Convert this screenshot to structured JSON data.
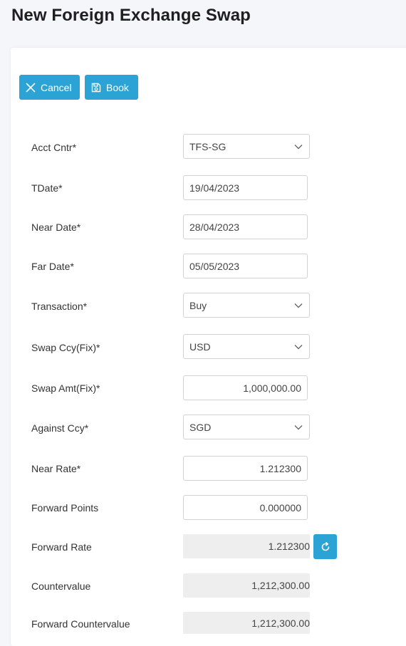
{
  "page": {
    "title": "New Foreign Exchange Swap"
  },
  "toolbar": {
    "cancel_label": "Cancel",
    "book_label": "Book"
  },
  "form": {
    "acct_cntr": {
      "label": "Acct Cntr*",
      "value": "TFS-SG"
    },
    "tdate": {
      "label": "TDate*",
      "value": "19/04/2023"
    },
    "near_date": {
      "label": "Near Date*",
      "value": "28/04/2023"
    },
    "far_date": {
      "label": "Far Date*",
      "value": "05/05/2023"
    },
    "transaction": {
      "label": "Transaction*",
      "value": "Buy"
    },
    "swap_ccy": {
      "label": "Swap Ccy(Fix)*",
      "value": "USD"
    },
    "swap_amt": {
      "label": "Swap Amt(Fix)*",
      "value": "1,000,000.00"
    },
    "against_ccy": {
      "label": "Against Ccy*",
      "value": "SGD"
    },
    "near_rate": {
      "label": "Near Rate*",
      "value": "1.212300"
    },
    "forward_points": {
      "label": "Forward Points",
      "value": "0.000000"
    },
    "forward_rate": {
      "label": "Forward Rate",
      "value": "1.212300"
    },
    "countervalue": {
      "label": "Countervalue",
      "value": "1,212,300.00"
    },
    "forward_countervalue": {
      "label": "Forward Countervalue",
      "value": "1,212,300.00"
    }
  },
  "icons": {
    "cancel": "close-icon",
    "book": "save-icon",
    "dropdown": "chevron-down-icon",
    "refresh": "refresh-icon"
  },
  "colors": {
    "accent": "#2ba3d4",
    "readonly_bg": "#eeeeee",
    "page_bg": "#f4f6f9"
  }
}
